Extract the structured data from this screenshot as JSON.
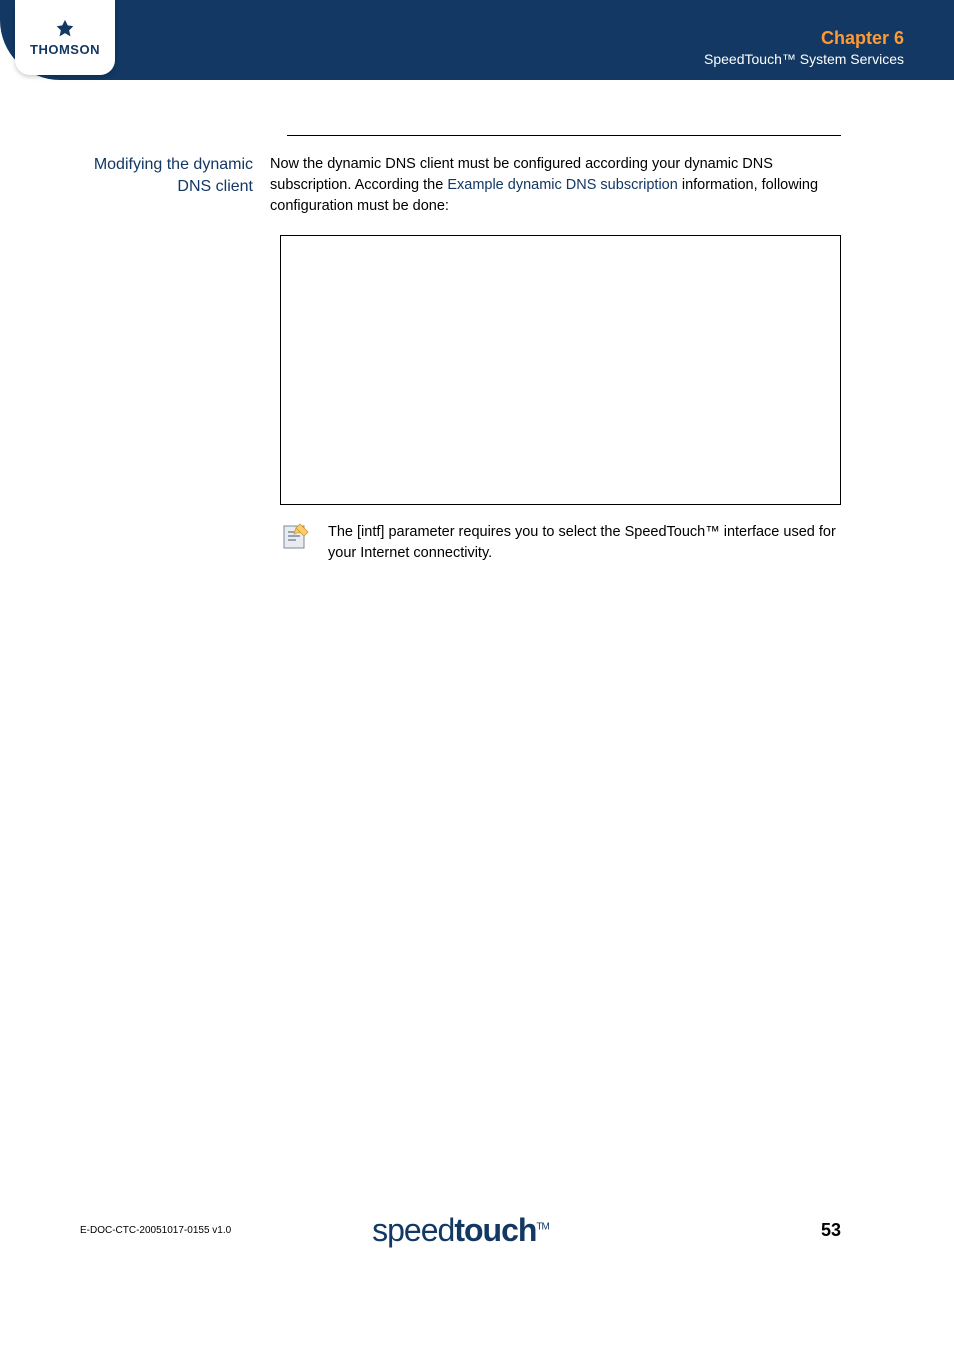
{
  "header": {
    "logo_text": "THOMSON",
    "chapter_title": "Chapter 6",
    "chapter_subtitle": "SpeedTouch™ System Services"
  },
  "section": {
    "label": "Modifying the dynamic DNS client",
    "body_prefix": "Now the dynamic DNS client must be configured according your dynamic DNS subscription. According the ",
    "body_link": "Example dynamic DNS subscription",
    "body_suffix": " information, following configuration must be done:"
  },
  "note": {
    "text": "The [intf] parameter requires you to select the SpeedTouch™ interface used for your Internet connectivity."
  },
  "footer": {
    "doc_id": "E-DOC-CTC-20051017-0155 v1.0",
    "logo_light": "speed",
    "logo_bold": "touch",
    "logo_tm": "TM",
    "page_number": "53"
  }
}
